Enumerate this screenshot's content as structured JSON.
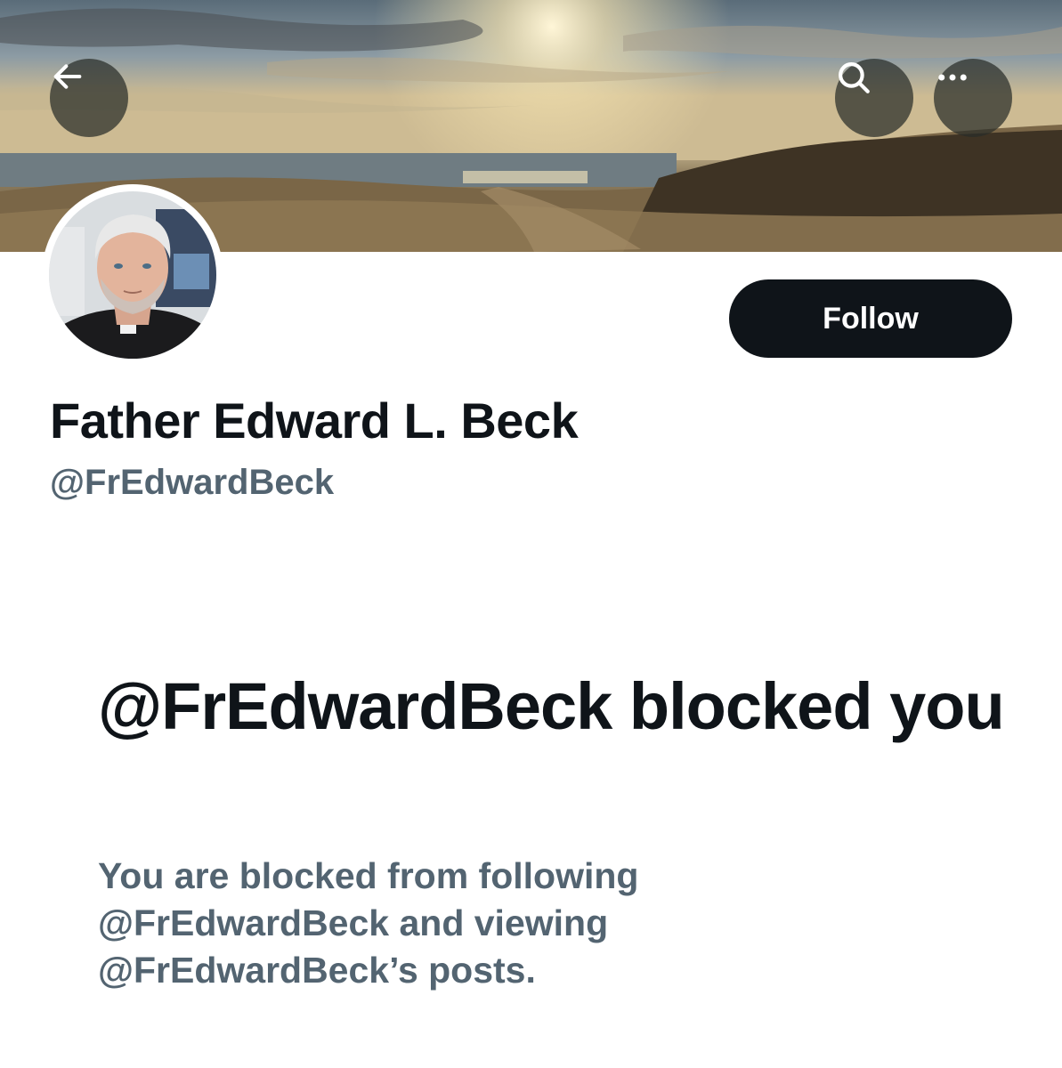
{
  "header": {
    "back_icon": "arrow-left-icon",
    "search_icon": "search-icon",
    "more_icon": "more-horizontal-icon"
  },
  "profile": {
    "display_name": "Father Edward L. Beck",
    "handle": "@FrEdwardBeck",
    "follow_label": "Follow"
  },
  "blocked_notice": {
    "title": "@FrEdwardBeck blocked you",
    "description": "You are blocked from following @FrEdwardBeck and viewing @FrEdwardBeck’s posts."
  },
  "colors": {
    "text_primary": "#0f1419",
    "text_secondary": "#536471",
    "button_bg": "#0f1419",
    "button_text": "#ffffff"
  }
}
